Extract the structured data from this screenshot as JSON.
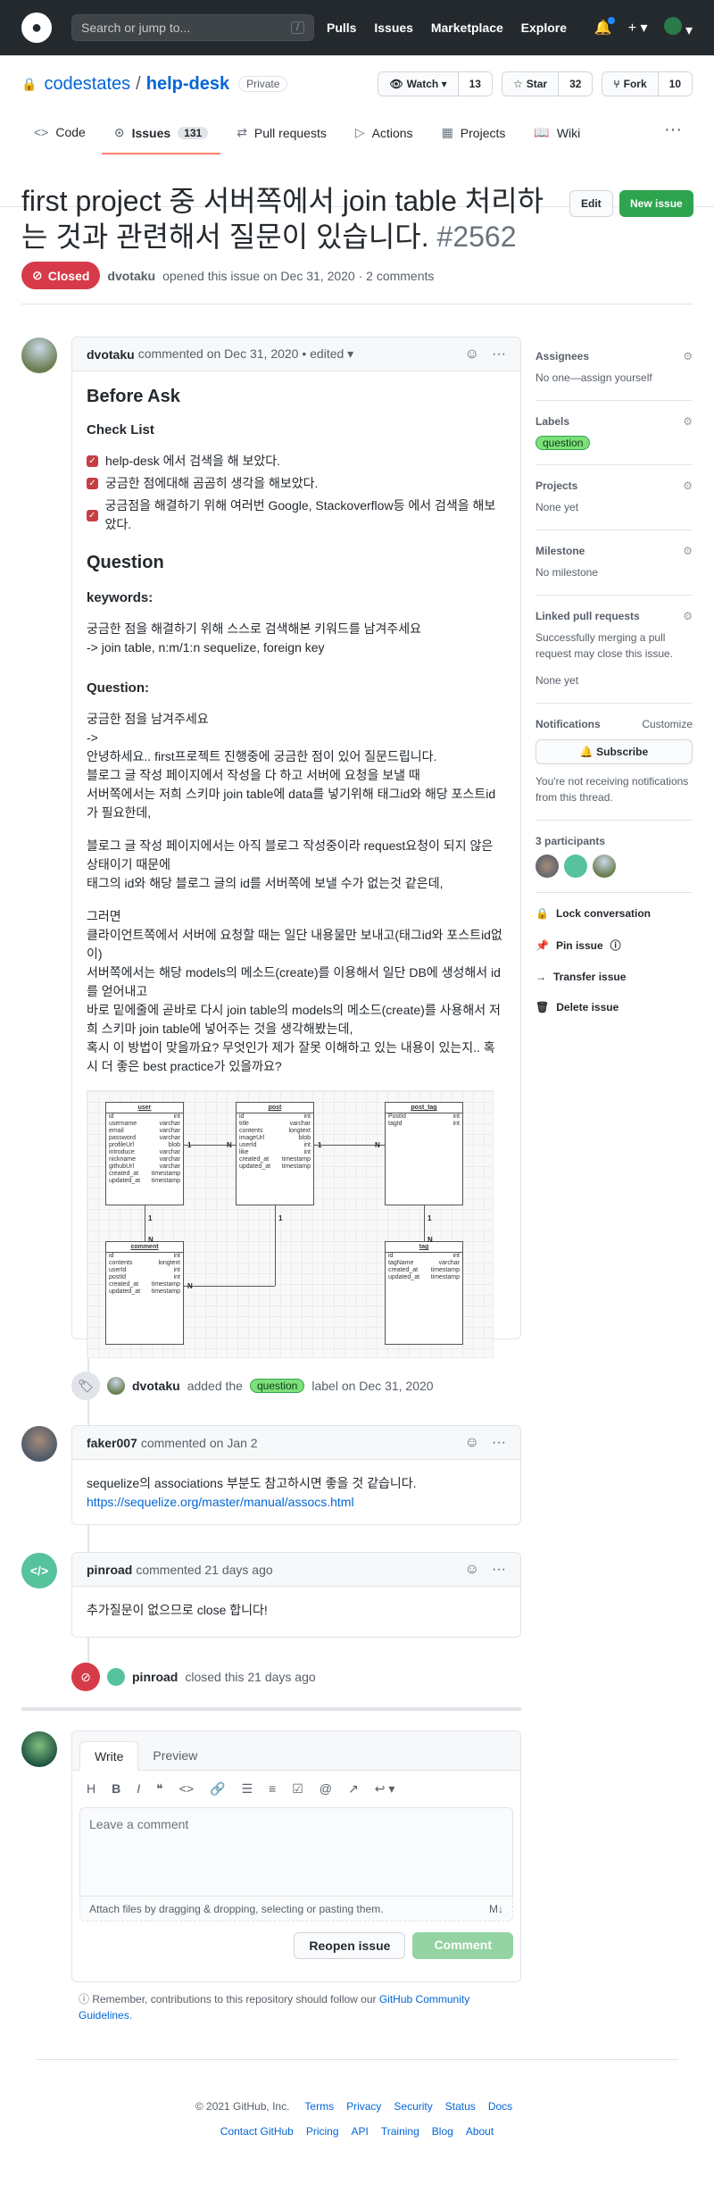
{
  "header": {
    "search_placeholder": "Search or jump to...",
    "slash": "/",
    "nav": [
      "Pulls",
      "Issues",
      "Marketplace",
      "Explore"
    ]
  },
  "repo": {
    "owner": "codestates",
    "name": "help-desk",
    "visibility": "Private",
    "watch": "Watch",
    "watch_count": "13",
    "star": "Star",
    "star_count": "32",
    "fork": "Fork",
    "fork_count": "10"
  },
  "tabs": {
    "code": "Code",
    "issues": "Issues",
    "issues_count": "131",
    "pulls": "Pull requests",
    "actions": "Actions",
    "projects": "Projects",
    "wiki": "Wiki"
  },
  "issue": {
    "title": "first project 중 서버쪽에서 join table 처리하는 것과 관련해서 질문이 있습니다.",
    "number": "#2562",
    "edit": "Edit",
    "new_issue": "New issue",
    "state": "Closed",
    "author": "dvotaku",
    "meta": "opened this issue on Dec 31, 2020 · 2 comments"
  },
  "c1": {
    "author": "dvotaku",
    "meta": "commented on Dec 31, 2020 • edited ▾",
    "h_before": "Before Ask",
    "h_check": "Check List",
    "tasks": [
      "help-desk 에서 검색을 해 보았다.",
      "궁금한 점에대해 곰곰히 생각을 해보았다.",
      "궁금점을 해결하기 위해 여러번 Google, Stackoverflow등 에서 검색을 해보았다."
    ],
    "h_question": "Question",
    "h_keywords": "keywords:",
    "kw_text": "궁금한 점을 해결하기 위해 스스로 검색해본 키워드를 남겨주세요\n-> join table, n:m/1:n sequelize, foreign key",
    "h_question2": "Question:",
    "q1": "궁금한 점을 남겨주세요\n->\n안녕하세요.. first프로젝트 진행중에 궁금한 점이 있어 질문드립니다.\n블로그 글 작성 페이지에서 작성을 다 하고 서버에 요청을 보낼 때\n서버쪽에서는 저희 스키마 join table에 data를 넣기위해 태그id와 해당 포스트id가 필요한데,",
    "q2": "블로그 글 작성 페이지에서는 아직 블로그 작성중이라 request요청이 되지 않은 상태이기 때문에\n태그의 id와 해당 블로그 글의 id를 서버쪽에 보낼 수가 없는것 같은데,",
    "q3": "그러면\n클라이언트쪽에서 서버에 요청할 때는 일단 내용물만 보내고(태그id와 포스트id없이)\n서버쪽에서는 해당 models의 메소드(create)를 이용해서 일단 DB에 생성해서 id를 얻어내고\n바로 밑에줄에 곧바로 다시 join table의 models의 메소드(create)를 사용해서 저희 스키마 join table에 넣어주는 것을 생각해봤는데,\n혹시 이 방법이 맞을까요? 무엇인가 제가 잘못 이해하고 있는 내용이 있는지.. 혹시 더 좋은 best practice가 있을까요?"
  },
  "erd": {
    "user": {
      "name": "user",
      "rows": [
        [
          "id",
          "int"
        ],
        [
          "username",
          "varchar"
        ],
        [
          "email",
          "varchar"
        ],
        [
          "password",
          "varchar"
        ],
        [
          "profileUrl",
          "blob"
        ],
        [
          "introduce",
          "varchar"
        ],
        [
          "nickname",
          "varchar"
        ],
        [
          "githubUrl",
          "varchar"
        ],
        [
          "created_at",
          "timestamp"
        ],
        [
          "updated_at",
          "timestamp"
        ]
      ]
    },
    "post": {
      "name": "post",
      "rows": [
        [
          "id",
          "int"
        ],
        [
          "title",
          "varchar"
        ],
        [
          "contents",
          "longtext"
        ],
        [
          "imageUrl",
          "blob"
        ],
        [
          "userId",
          "int"
        ],
        [
          "like",
          "int"
        ],
        [
          "created_at",
          "timestamp"
        ],
        [
          "updated_at",
          "timestamp"
        ]
      ]
    },
    "post_tag": {
      "name": "post_tag",
      "rows": [
        [
          "PostId",
          "int"
        ],
        [
          "tagId",
          "int"
        ]
      ]
    },
    "comment": {
      "name": "comment",
      "rows": [
        [
          "id",
          "int"
        ],
        [
          "contents",
          "longtext"
        ],
        [
          "userId",
          "int"
        ],
        [
          "postId",
          "int"
        ],
        [
          "created_at",
          "timestamp"
        ],
        [
          "updated_at",
          "timestamp"
        ]
      ]
    },
    "tag": {
      "name": "tag",
      "rows": [
        [
          "id",
          "int"
        ],
        [
          "tagName",
          "varchar"
        ],
        [
          "created_at",
          "timestamp"
        ],
        [
          "updated_at",
          "timestamp"
        ]
      ]
    },
    "one": "1",
    "many": "N"
  },
  "event_label": {
    "author": "dvotaku",
    "pre": "added the",
    "label": "question",
    "post": "label on Dec 31, 2020"
  },
  "c2": {
    "author": "faker007",
    "meta": "commented on Jan 2",
    "text": "sequelize의 associations 부분도 참고하시면 좋을 것 같습니다.",
    "link": "https://sequelize.org/master/manual/assocs.html"
  },
  "c3": {
    "author": "pinroad",
    "meta": "commented 21 days ago",
    "text": "추가질문이 없으므로 close 합니다!"
  },
  "event_close": {
    "author": "pinroad",
    "text": "closed this 21 days ago"
  },
  "composer": {
    "write": "Write",
    "preview": "Preview",
    "placeholder": "Leave a comment",
    "attach": "Attach files by dragging & dropping, selecting or pasting them.",
    "reopen": "Reopen issue",
    "comment": "Comment",
    "note": "Remember, contributions to this repository should follow our",
    "guidelines": "GitHub Community Guidelines."
  },
  "sidebar": {
    "assignees": "Assignees",
    "assignees_val": "No one—assign yourself",
    "labels": "Labels",
    "label": "question",
    "projects": "Projects",
    "projects_val": "None yet",
    "milestone": "Milestone",
    "milestone_val": "No milestone",
    "linked": "Linked pull requests",
    "linked_desc": "Successfully merging a pull request may close this issue.",
    "linked_val": "None yet",
    "notifications": "Notifications",
    "customize": "Customize",
    "subscribe": "Subscribe",
    "notif_desc": "You're not receiving notifications from this thread.",
    "participants": "3 participants",
    "lock": "Lock conversation",
    "pin": "Pin issue",
    "transfer": "Transfer issue",
    "delete": "Delete issue"
  },
  "footer": {
    "copy": "© 2021 GitHub, Inc.",
    "links1": [
      "Terms",
      "Privacy",
      "Security",
      "Status",
      "Docs"
    ],
    "links2": [
      "Contact GitHub",
      "Pricing",
      "API",
      "Training",
      "Blog",
      "About"
    ]
  }
}
